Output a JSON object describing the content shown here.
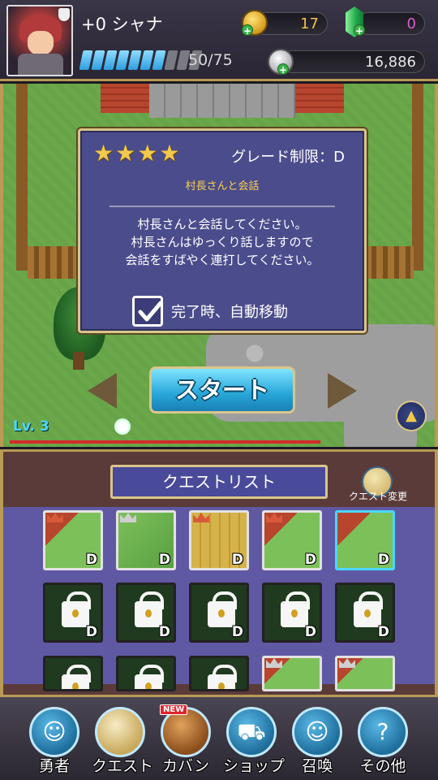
{
  "header": {
    "player_name": "+0 シャナ",
    "stamina_text": "50/75",
    "stamina": {
      "current": 50,
      "max": 75,
      "segments_total": 10,
      "segments_filled": 7
    },
    "coins": "17",
    "gems": "0",
    "silver": "16,886"
  },
  "popup": {
    "stars": 4,
    "grade_limit": "グレード制限：D",
    "quest_title": "村長さんと会話",
    "description": [
      "村長さんと会話してください。",
      "村長さんはゆっくり話しますので",
      "会話をすばやく連打してください。"
    ],
    "auto_move_label": "完了時、自動移動",
    "auto_move_checked": true
  },
  "map": {
    "start_label": "スタート",
    "level": "Lv. 3",
    "xp_fraction": 0.72
  },
  "quest_list": {
    "title": "クエストリスト",
    "change_label": "クエスト変更",
    "tiles": [
      {
        "state": "open",
        "crown": "gold",
        "grade": "D"
      },
      {
        "state": "open",
        "crown": "silver",
        "grade": "D"
      },
      {
        "state": "open",
        "crown": "gold",
        "grade": "D"
      },
      {
        "state": "open",
        "crown": "gold",
        "grade": "D"
      },
      {
        "state": "open",
        "crown": "none",
        "grade": "D",
        "selected": true
      },
      {
        "state": "locked",
        "grade": "D"
      },
      {
        "state": "locked",
        "grade": "D"
      },
      {
        "state": "locked",
        "grade": "D"
      },
      {
        "state": "locked",
        "grade": "D"
      },
      {
        "state": "locked",
        "grade": "D"
      },
      {
        "state": "locked",
        "grade": ""
      },
      {
        "state": "locked",
        "grade": ""
      },
      {
        "state": "locked",
        "grade": ""
      },
      {
        "state": "open",
        "crown": "silver",
        "grade": ""
      },
      {
        "state": "open",
        "crown": "silver",
        "grade": ""
      }
    ]
  },
  "nav": {
    "items": [
      {
        "label": "勇者",
        "icon": "hero-icon"
      },
      {
        "label": "クエスト",
        "icon": "map-icon"
      },
      {
        "label": "カバン",
        "icon": "bag-icon",
        "badge": "NEW"
      },
      {
        "label": "ショップ",
        "icon": "cart-icon"
      },
      {
        "label": "召喚",
        "icon": "summon-icon"
      },
      {
        "label": "その他",
        "icon": "help-icon"
      }
    ]
  },
  "colors": {
    "accent_gold": "#d9c58a",
    "popup_bg": "#4b4c8c",
    "start_button": "#27a6d8",
    "xp_bar": "#d42a2a",
    "quest_title": "#ffd24a"
  }
}
